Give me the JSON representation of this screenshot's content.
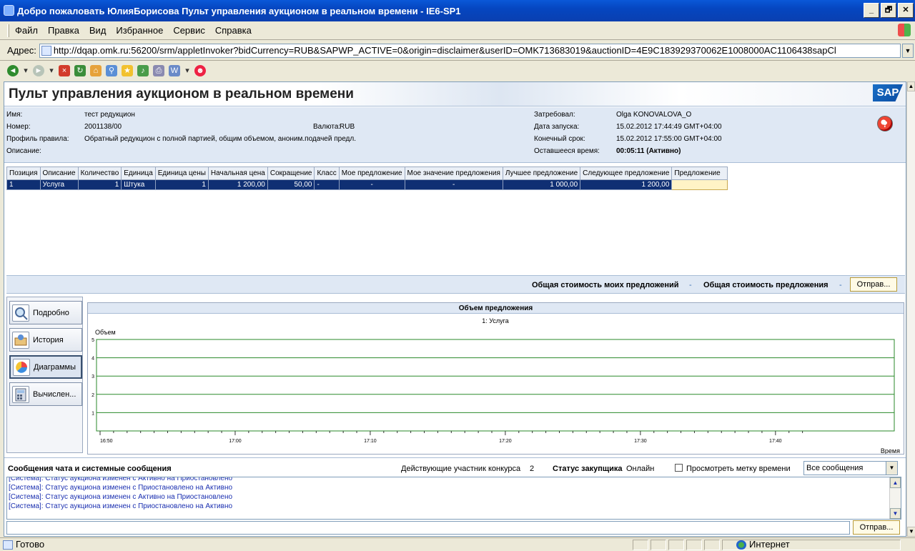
{
  "window": {
    "title": "Добро пожаловать ЮлияБорисова Пульт управления аукционом в реальном времени - IE6-SP1",
    "minimize": "_",
    "maximize": "🗗",
    "close": "✕"
  },
  "menu": [
    "Файл",
    "Правка",
    "Вид",
    "Избранное",
    "Сервис",
    "Справка"
  ],
  "address": {
    "label": "Адрес:",
    "url": "http://dqap.omk.ru:56200/srm/appletInvoker?bidCurrency=RUB&SAPWP_ACTIVE=0&origin=disclaimer&userID=OMK713683019&auctionID=4E9C183929370062E1008000AC1106438sapCl"
  },
  "toolbar_icons": [
    "back-icon",
    "forward-icon",
    "stop-icon",
    "refresh-icon",
    "home-icon",
    "search-icon",
    "favorites-icon",
    "media-icon",
    "mail-icon",
    "edit-icon",
    "messenger-icon"
  ],
  "app": {
    "title": "Пульт управления аукционом в реальном времени",
    "logo": "SAP"
  },
  "info": {
    "name_label": "Имя:",
    "name_value": "тест редукцион",
    "number_label": "Номер:",
    "number_value": "2001138/00",
    "currency_label": "Валюта:",
    "currency_value": "RUB",
    "profile_label": "Профиль правила:",
    "profile_value": "Обратный редукцион с полной партией, общим объемом, аноним.подачей предл.",
    "description_label": "Описание:",
    "requester_label": "Затребовал:",
    "requester_value": "Olga KONOVALOVA_O",
    "start_label": "Дата запуска:",
    "start_value": "15.02.2012 17:44:49 GMT+04:00",
    "deadline_label": "Конечный срок:",
    "deadline_value": "15.02.2012 17:55:00 GMT+04:00",
    "remaining_label": "Оставшееся время:",
    "remaining_value": "00:05:11 (Активно)"
  },
  "table": {
    "headers": [
      "Позиция",
      "Описание",
      "Количество",
      "Единица",
      "Единица цены",
      "Начальная цена",
      "Сокращение",
      "Класс",
      "Мое предложение",
      "Мое значение предложения",
      "Лучшее предложение",
      "Следующее предложение",
      "Предложение"
    ],
    "rows": [
      [
        "1",
        "Услуга",
        "1",
        "Штука",
        "1",
        "1 200,00",
        "50,00",
        "-",
        "-",
        "-",
        "1 000,00",
        "1 200,00",
        ""
      ]
    ]
  },
  "totals": {
    "my_total_label": "Общая стоимость моих предложений",
    "my_total_value": "-",
    "total_label": "Общая стоимость предложения",
    "total_value": "-",
    "send_button": "Отправ..."
  },
  "nav": [
    {
      "label": "Подробно",
      "icon": "details-icon"
    },
    {
      "label": "История",
      "icon": "history-icon"
    },
    {
      "label": "Диаграммы",
      "icon": "charts-icon",
      "active": true
    },
    {
      "label": "Вычислен...",
      "icon": "calculator-icon"
    }
  ],
  "chart_data": {
    "type": "line",
    "title": "Объем предложения",
    "subtitle": "1: Услуга",
    "ylabel": "Объем",
    "xlabel": "Время",
    "ylim": [
      0,
      5
    ],
    "yticks": [
      1,
      2,
      3,
      4,
      5
    ],
    "xticks": [
      "16:50",
      "17:00",
      "17:10",
      "17:20",
      "17:30",
      "17:40"
    ],
    "grid": true,
    "series": []
  },
  "chat": {
    "title": "Сообщения чата и системные сообщения",
    "participants_label": "Действующие участник конкурса",
    "participants_value": "2",
    "buyer_status_label": "Статус закупщика",
    "buyer_status_value": "Онлайн",
    "timestamp_label": "Просмотреть метку времени",
    "filter_value": "Все сообщения",
    "messages": [
      "[Система]: Статус аукциона изменен с Активно на Приостановлено",
      "[Система]: Статус аукциона изменен с Приостановлено на Активно",
      "[Система]: Статус аукциона изменен с Активно на Приостановлено",
      "[Система]: Статус аукциона изменен с Приостановлено на Активно"
    ],
    "send_button": "Отправ..."
  },
  "status": {
    "text": "Готово",
    "zone": "Интернет"
  }
}
